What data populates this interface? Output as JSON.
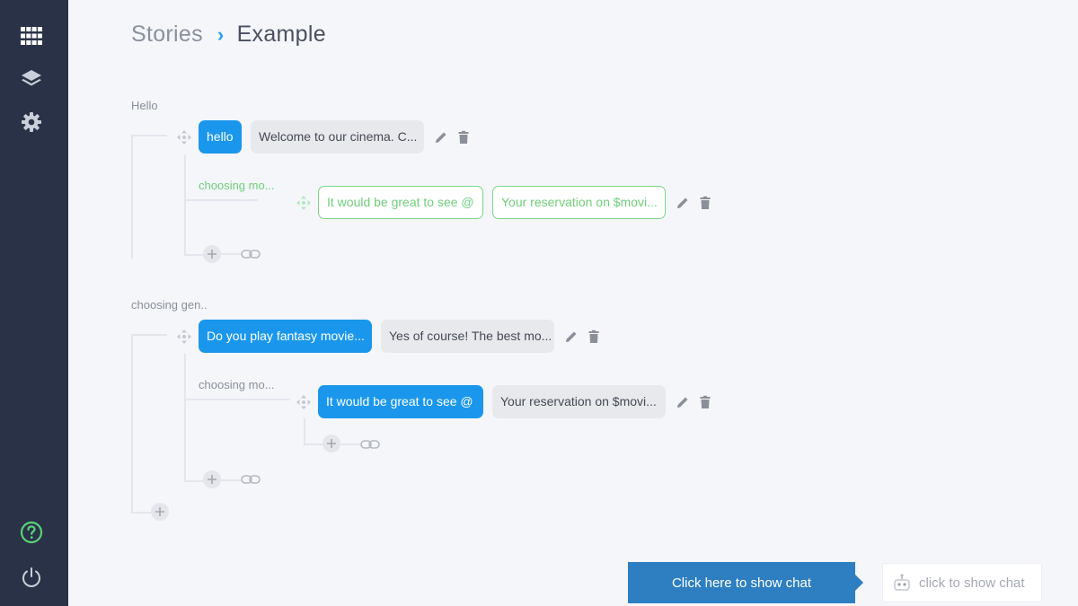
{
  "sidebar": {
    "icons": [
      "grid-icon",
      "layers-icon",
      "gear-icon",
      "help-icon",
      "power-icon"
    ]
  },
  "breadcrumb": {
    "root": "Stories",
    "separator": "›",
    "current": "Example"
  },
  "stories": [
    {
      "title": "Hello",
      "user_message": "hello",
      "bot_response": "Welcome to our cinema. C...",
      "branch": {
        "intent": "choosing mo...",
        "user_message": "It would be great to see @",
        "bot_response": "Your reservation on $movi..."
      }
    },
    {
      "title": "choosing gen..",
      "user_message": "Do you play fantasy movie...",
      "bot_response": "Yes of course! The best mo...",
      "branch": {
        "intent": "choosing mo...",
        "user_message": "It would be great to see @",
        "bot_response": "Your reservation on $movi..."
      }
    }
  ],
  "chat": {
    "button_label": "Click here to show chat",
    "widget_label": "click to show chat"
  },
  "colors": {
    "sidebar_bg": "#2a3247",
    "accent_blue": "#1a97ec",
    "highlight_green": "#6fcf7a",
    "chat_button": "#2e7fc1"
  }
}
